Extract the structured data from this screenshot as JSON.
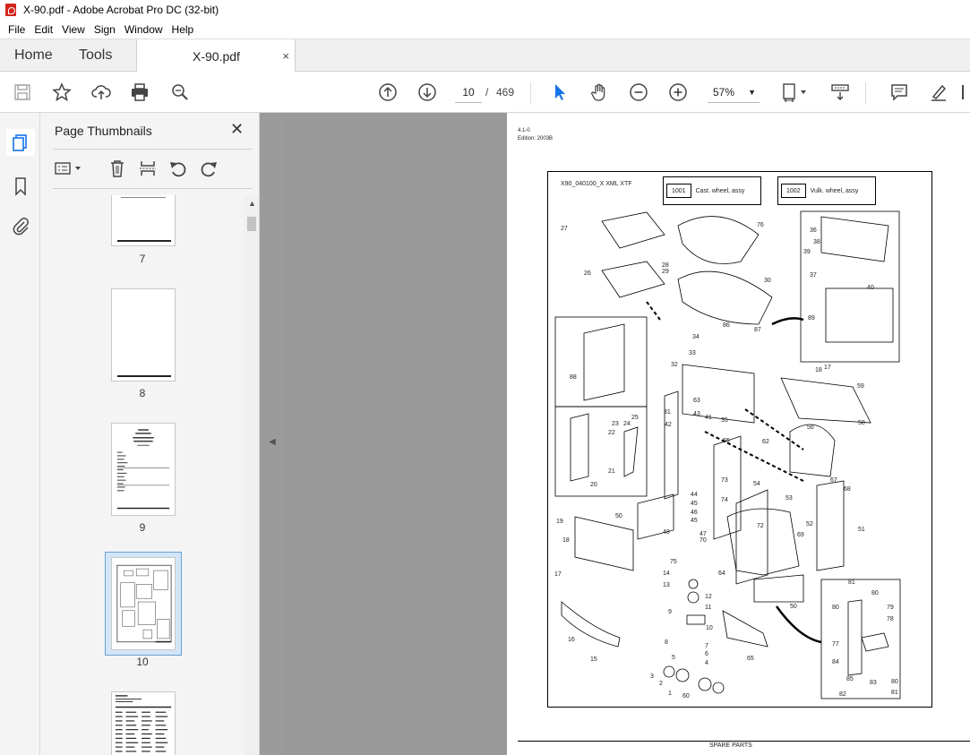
{
  "window": {
    "title": "X-90.pdf - Adobe Acrobat Pro DC (32-bit)"
  },
  "menu": [
    "File",
    "Edit",
    "View",
    "Sign",
    "Window",
    "Help"
  ],
  "tabs": {
    "home": "Home",
    "tools": "Tools",
    "document": "X-90.pdf",
    "close": "×"
  },
  "toolbar": {
    "current_page": "10",
    "page_separator": "/",
    "total_pages": "469",
    "zoom": "57%"
  },
  "panel": {
    "title": "Page Thumbnails",
    "thumbnails": [
      {
        "num": "7"
      },
      {
        "num": "8"
      },
      {
        "num": "9"
      },
      {
        "num": "10"
      }
    ]
  },
  "page": {
    "header_line1": "4.1-0",
    "header_line2": "Edition: 2003B",
    "drawing_code": "X90_040100_X XML XTF",
    "legend": [
      {
        "num": "1001",
        "text": "Cast. wheel, assy"
      },
      {
        "num": "1002",
        "text": "Vulk. wheel, assy"
      }
    ],
    "footer": "SPARE PARTS",
    "part_labels": [
      "27",
      "76",
      "28",
      "29",
      "26",
      "30",
      "36",
      "38",
      "39",
      "40",
      "37",
      "89",
      "86",
      "87",
      "34",
      "33",
      "32",
      "88",
      "63",
      "43",
      "41",
      "35",
      "31",
      "42",
      "18",
      "17",
      "59",
      "56",
      "58",
      "55",
      "62",
      "23",
      "24",
      "25",
      "22",
      "21",
      "20",
      "73",
      "74",
      "54",
      "67",
      "68",
      "44",
      "45",
      "46",
      "50",
      "53",
      "72",
      "19",
      "45",
      "48",
      "47",
      "70",
      "52",
      "69",
      "51",
      "18",
      "17",
      "75",
      "14",
      "64",
      "13",
      "12",
      "11",
      "9",
      "10",
      "16",
      "15",
      "8",
      "7",
      "6",
      "5",
      "4",
      "3",
      "2",
      "1",
      "60",
      "65",
      "50",
      "81",
      "80",
      "79",
      "80",
      "78",
      "77",
      "84",
      "85",
      "83",
      "82",
      "80",
      "81"
    ]
  }
}
